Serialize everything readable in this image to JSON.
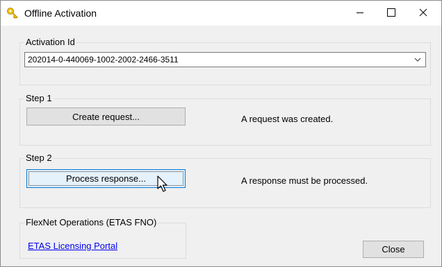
{
  "window": {
    "title": "Offline Activation",
    "icons": {
      "app": "key-icon",
      "minimize": "minimize-icon",
      "maximize": "maximize-icon",
      "close": "close-icon"
    }
  },
  "activation": {
    "group_label": "Activation Id",
    "selected_value": "202014-0-440069-1002-2002-2466-3511"
  },
  "step1": {
    "group_label": "Step 1",
    "button_label": "Create request...",
    "status": "A request was created."
  },
  "step2": {
    "group_label": "Step 2",
    "button_label": "Process response...",
    "status": "A response must be processed."
  },
  "flexnet": {
    "group_label": "FlexNet Operations (ETAS FNO)",
    "link_text": "ETAS Licensing Portal"
  },
  "footer": {
    "close_label": "Close"
  },
  "colors": {
    "link": "#0000ee",
    "focus_border": "#0078d7",
    "key_icon": "#f0b400"
  }
}
